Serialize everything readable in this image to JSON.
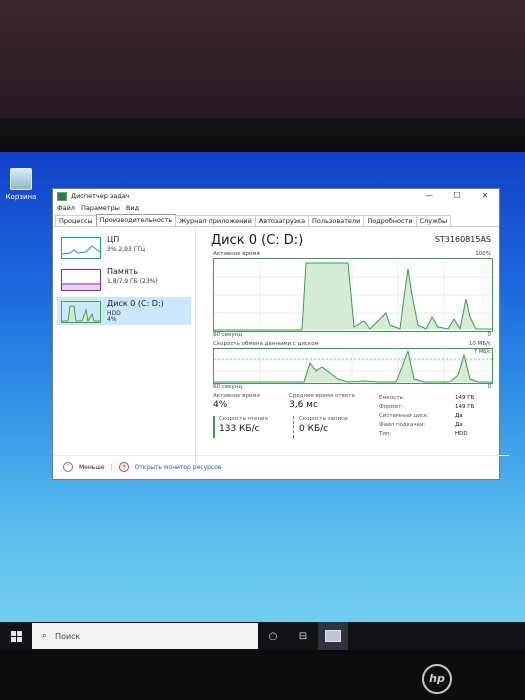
{
  "desktop": {
    "recycle_bin_label": "Корзина"
  },
  "window": {
    "title": "Диспетчер задач",
    "controls": {
      "minimize": "—",
      "maximize": "☐",
      "close": "✕"
    }
  },
  "menu": [
    "Файл",
    "Параметры",
    "Вид"
  ],
  "tabs": [
    {
      "label": "Процессы"
    },
    {
      "label": "Производительность",
      "active": true
    },
    {
      "label": "Журнал приложений"
    },
    {
      "label": "Автозагрузка"
    },
    {
      "label": "Пользователи"
    },
    {
      "label": "Подробности"
    },
    {
      "label": "Службы"
    }
  ],
  "sidebar": [
    {
      "name": "ЦП",
      "sub": "3% 2,93 ГГц",
      "sub2": "",
      "color": "#1f8fd6"
    },
    {
      "name": "Память",
      "sub": "1,8/7,9 ГБ (23%)",
      "sub2": "",
      "color": "#8b2fa8"
    },
    {
      "name": "Диск 0 (C: D:)",
      "sub": "HDD",
      "sub2": "4%",
      "color": "#4aa24e",
      "selected": true
    }
  ],
  "disk": {
    "title": "Диск 0 (C: D:)",
    "model": "ST3160815AS",
    "graph1_label": "Активное время",
    "graph1_max": "100%",
    "graph1_time": "60 секунд",
    "graph1_min": "0",
    "graph2_label": "Скорость обмена данными с диском",
    "graph2_max": "10 МБ/с",
    "graph2_mid": "7 МБ/с",
    "graph2_time": "60 секунд",
    "graph2_min": "0",
    "stats": {
      "active_time_label": "Активное время",
      "active_time_value": "4%",
      "response_label": "Среднее время ответа",
      "response_value": "3,6 мс",
      "read_label": "Скорость чтения",
      "read_value": "133 КБ/с",
      "write_label": "Скорость записи",
      "write_value": "0 КБ/с"
    },
    "properties": [
      {
        "key": "Емкость:",
        "value": "149 ГБ"
      },
      {
        "key": "Формат:",
        "value": "149 ГБ"
      },
      {
        "key": "Системный диск:",
        "value": "Да"
      },
      {
        "key": "Файл подкачки:",
        "value": "Да"
      },
      {
        "key": "Тип:",
        "value": "HDD"
      }
    ]
  },
  "footer": {
    "less_label": "Меньше",
    "monitor_link": "Открыть монитор ресурсов"
  },
  "taskbar": {
    "search_placeholder": "Поиск"
  },
  "colors": {
    "graph_green": "#3e9a4e",
    "accent_blue": "#1a5dbf"
  }
}
